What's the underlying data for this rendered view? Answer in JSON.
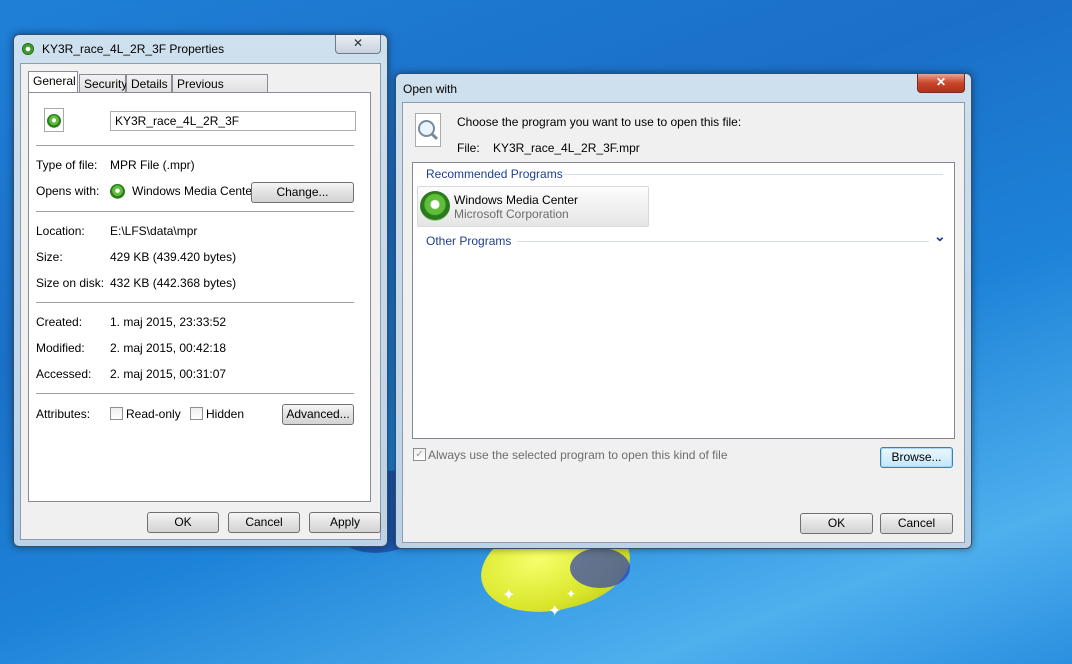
{
  "properties": {
    "title": "KY3R_race_4L_2R_3F Properties",
    "close_glyph": "✕",
    "tabs": [
      "General",
      "Security",
      "Details",
      "Previous Versions"
    ],
    "filename": "KY3R_race_4L_2R_3F",
    "type_label": "Type of file:",
    "type_value": "MPR File (.mpr)",
    "opens_label": "Opens with:",
    "opens_value": "Windows Media Center",
    "change_label": "Change...",
    "location_label": "Location:",
    "location_value": "E:\\LFS\\data\\mpr",
    "size_label": "Size:",
    "size_value": "429 KB (439.420 bytes)",
    "disk_label": "Size on disk:",
    "disk_value": "432 KB (442.368 bytes)",
    "created_label": "Created:",
    "created_value": "1. maj 2015, 23:33:52",
    "modified_label": "Modified:",
    "modified_value": "2. maj 2015, 00:42:18",
    "accessed_label": "Accessed:",
    "accessed_value": "2. maj 2015, 00:31:07",
    "attributes_label": "Attributes:",
    "readonly_label": "Read-only",
    "hidden_label": "Hidden",
    "advanced_label": "Advanced...",
    "ok_label": "OK",
    "cancel_label": "Cancel",
    "apply_label": "Apply"
  },
  "openwith": {
    "title": "Open with",
    "close_glyph": "✕",
    "instruction": "Choose the program you want to use to open this file:",
    "file_label": "File:",
    "file_value": "KY3R_race_4L_2R_3F.mpr",
    "recommended_header": "Recommended Programs",
    "program_name": "Windows Media Center",
    "program_company": "Microsoft Corporation",
    "other_header": "Other Programs",
    "expand_glyph": "⌄",
    "always_use_label": "Always use the selected program to open this kind of file",
    "always_use_checked": true,
    "check_glyph": "✓",
    "browse_label": "Browse...",
    "ok_label": "OK",
    "cancel_label": "Cancel"
  }
}
